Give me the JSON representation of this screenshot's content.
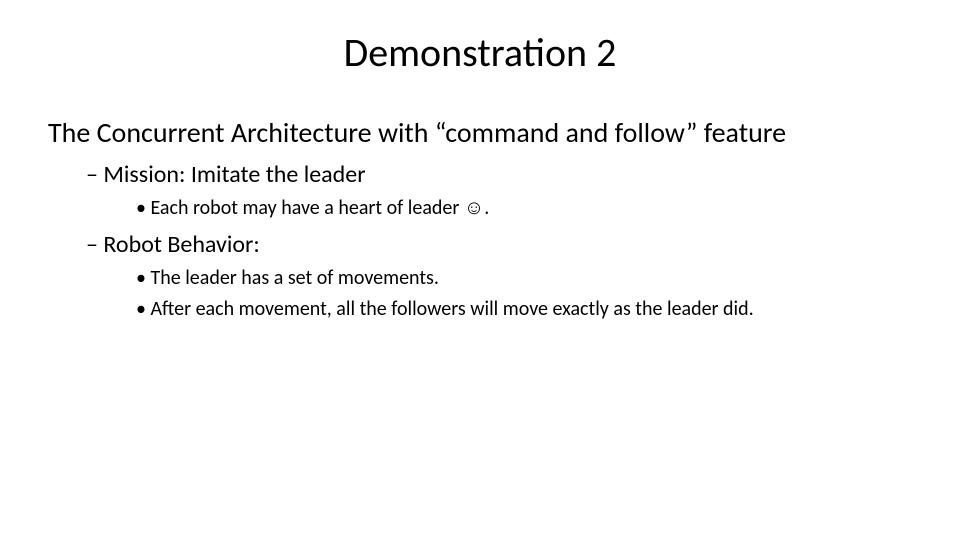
{
  "title": "Demonstration 2",
  "subtitle": "The Concurrent Architecture with “command and follow” feature",
  "sections": [
    {
      "heading": "Mission: Imitate the leader",
      "bullets": [
        "Each robot may have a heart of leader ☺."
      ]
    },
    {
      "heading": "Robot Behavior:",
      "bullets": [
        "The leader has a set of movements.",
        "After each movement, all the followers will move exactly as the leader did."
      ]
    }
  ]
}
